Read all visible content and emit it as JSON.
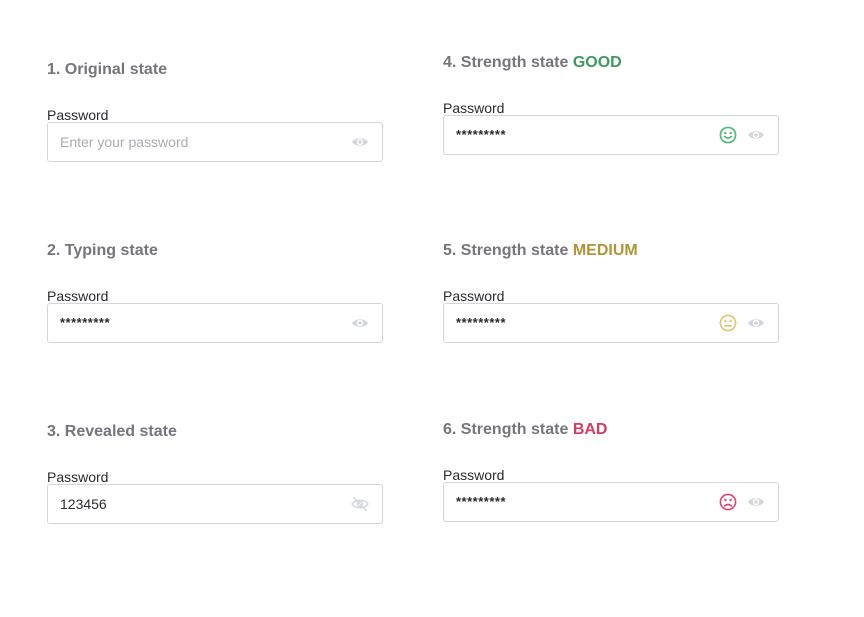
{
  "states": [
    {
      "title": "1. Original state",
      "status": "",
      "label": "Password",
      "value": "",
      "placeholder": "Enter your password",
      "eye_icon": "eye-icon",
      "strength_icon": null
    },
    {
      "title": "2. Typing state",
      "status": "",
      "label": "Password",
      "value": "*********",
      "placeholder": "",
      "eye_icon": "eye-icon",
      "strength_icon": null
    },
    {
      "title": "3. Revealed state",
      "status": "",
      "label": "Password",
      "value": "123456",
      "placeholder": "",
      "eye_icon": "eye-off-icon",
      "strength_icon": null
    },
    {
      "title": "4. Strength state",
      "status": "GOOD",
      "label": "Password",
      "value": "*********",
      "placeholder": "",
      "eye_icon": "eye-icon",
      "strength_icon": "smile-face-icon"
    },
    {
      "title": "5. Strength state",
      "status": "MEDIUM",
      "label": "Password",
      "value": "*********",
      "placeholder": "",
      "eye_icon": "eye-icon",
      "strength_icon": "neutral-face-icon"
    },
    {
      "title": "6. Strength state",
      "status": "BAD",
      "label": "Password",
      "value": "*********",
      "placeholder": "",
      "eye_icon": "eye-icon",
      "strength_icon": "sad-face-icon"
    }
  ],
  "colors": {
    "title": "#75757d",
    "good": "#3e9a5c",
    "medium": "#b39338",
    "bad": "#d23d61",
    "face_good": "#4cb86f",
    "face_medium": "#e2c56b",
    "face_bad": "#e0476c",
    "eye": "#d3d6dc",
    "border": "#d3d5d9"
  }
}
